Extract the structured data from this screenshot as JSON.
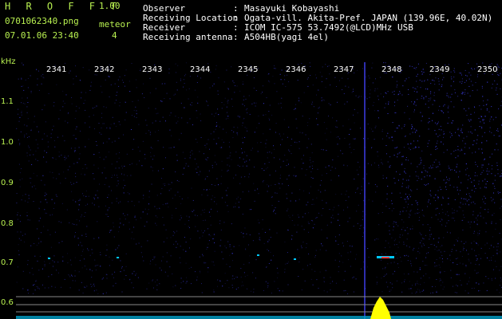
{
  "header": {
    "app_logo": "H R O F F T",
    "app_version": "1.00",
    "file_name": "0701062340.png",
    "timestamp": "07.01.06 23:40",
    "meteor_label": "meteor",
    "meteor_count": "4",
    "info": [
      {
        "key": "Observer",
        "sep": ":",
        "value": "Masayuki Kobayashi"
      },
      {
        "key": "Receiving Location",
        "sep": ":",
        "value": "Ogata-vill. Akita-Pref. JAPAN (139.96E, 40.02N)"
      },
      {
        "key": "Receiver",
        "sep": ":",
        "value": "ICOM IC-575 53.7492(@LCD)MHz USB"
      },
      {
        "key": "Receiving antenna",
        "sep": ":",
        "value": "A504HB(yagi 4el)"
      }
    ]
  },
  "spectrogram": {
    "y_unit": "kHz",
    "y_ticks": [
      "1.1",
      "1.0",
      "0.9",
      "0.8",
      "0.7",
      "0.6"
    ],
    "time_ticks": [
      "2341",
      "2342",
      "2343",
      "2344",
      "2345",
      "2346",
      "2347",
      "2348",
      "2349",
      "2350"
    ],
    "colors": {
      "background": "#000000",
      "noise": "#3a3ad8",
      "meteor": "#ffff00",
      "trace": "#00c8ff",
      "label_green": "#b8f050",
      "tick_white": "#ffffff"
    }
  }
}
